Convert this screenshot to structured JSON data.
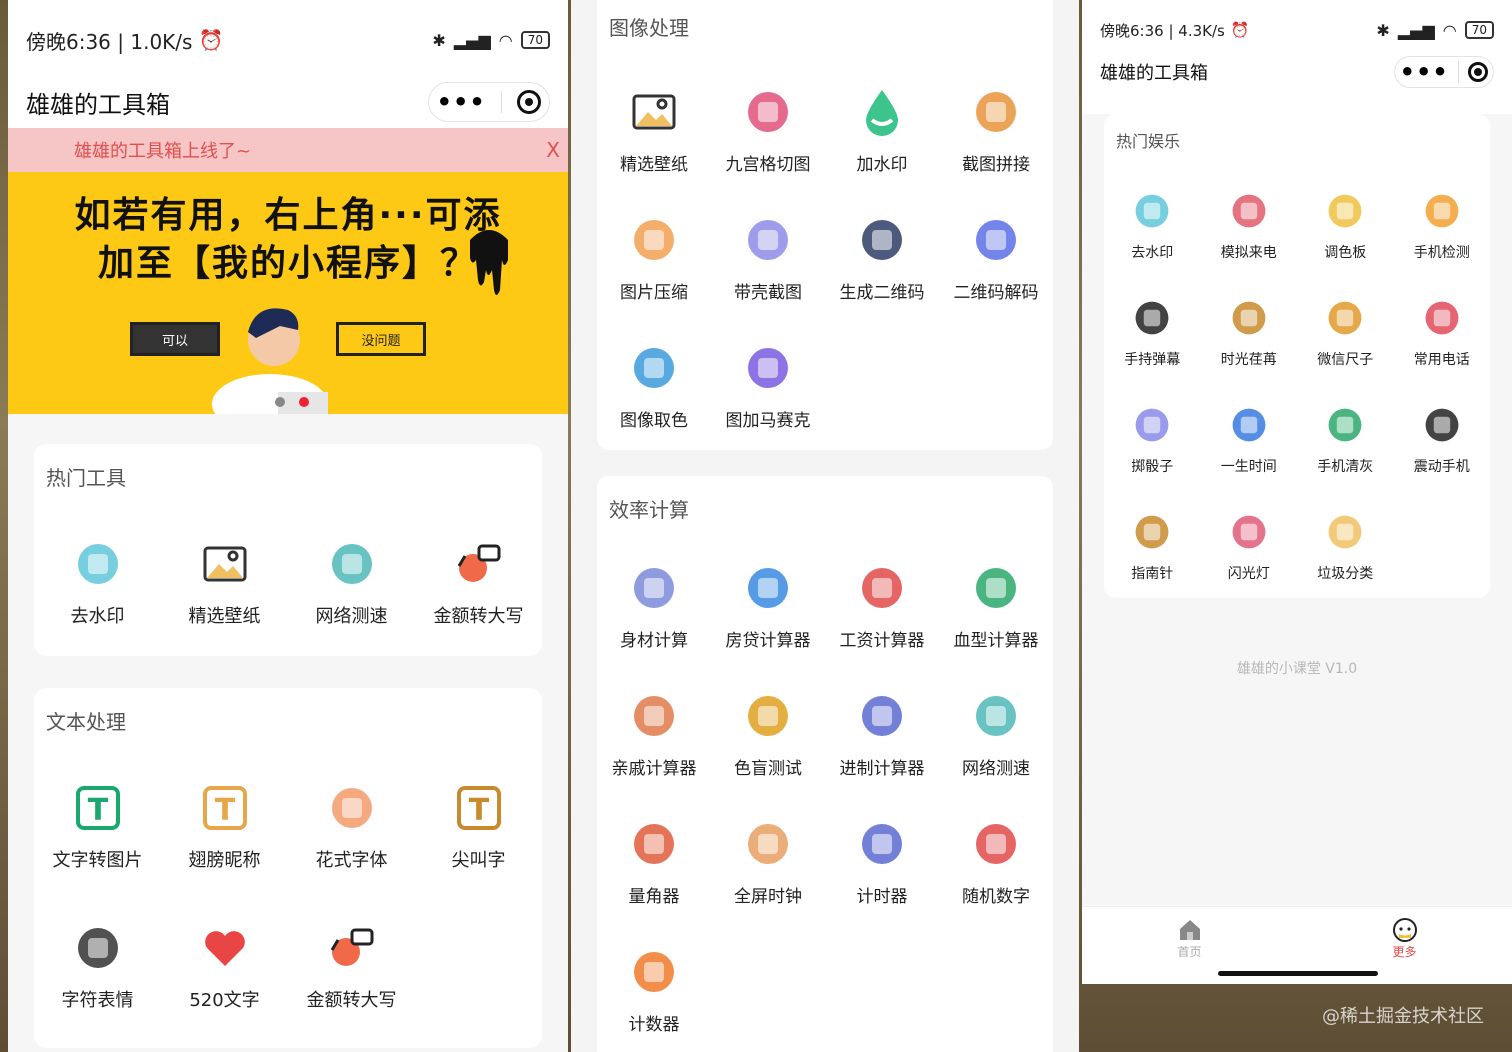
{
  "left": {
    "status": {
      "time": "傍晚6:36 | 1.0K/s",
      "battery": "70"
    },
    "title": "雄雄的工具箱",
    "notice": {
      "text": "雄雄的工具箱上线了~",
      "close": "X"
    },
    "banner": {
      "line1": "如若有用，右上角···可添",
      "line2": "加至【我的小程序】？",
      "btn_ok": "可以",
      "btn_no": "没问题"
    },
    "hot_tools": {
      "title": "热门工具",
      "items": [
        {
          "label": "去水印",
          "icon": "watermark-icon",
          "color": "#5fc6d8"
        },
        {
          "label": "精选壁纸",
          "icon": "image-icon",
          "color": "#333333"
        },
        {
          "label": "网络测速",
          "icon": "speed-gauge-icon",
          "color": "#4fb8b8"
        },
        {
          "label": "金额转大写",
          "icon": "exchange-icon",
          "color": "#f06a4a"
        }
      ]
    },
    "text_proc": {
      "title": "文本处理",
      "items": [
        {
          "label": "文字转图片",
          "icon": "text-t-icon",
          "color": "#1aa86e"
        },
        {
          "label": "翅膀昵称",
          "icon": "text-t-icon",
          "color": "#e8a64a"
        },
        {
          "label": "花式字体",
          "icon": "flower-icon",
          "color": "#f39a6b"
        },
        {
          "label": "尖叫字",
          "icon": "text-t-icon",
          "color": "#c9892d"
        },
        {
          "label": "字符表情",
          "icon": "symbols-icon",
          "color": "#333333"
        },
        {
          "label": "520文字",
          "icon": "heart-icon",
          "color": "#ea4545"
        },
        {
          "label": "金额转大写",
          "icon": "exchange-icon",
          "color": "#f06a4a"
        }
      ]
    }
  },
  "mid": {
    "image_proc": {
      "title": "图像处理",
      "items": [
        {
          "label": "精选壁纸",
          "icon": "image-icon",
          "color": "#333333"
        },
        {
          "label": "九宫格切图",
          "icon": "puzzle-icon",
          "color": "#e0507a"
        },
        {
          "label": "加水印",
          "icon": "water-drop-icon",
          "color": "#3cc48c"
        },
        {
          "label": "截图拼接",
          "icon": "crop-icon",
          "color": "#e8933a"
        },
        {
          "label": "图片压缩",
          "icon": "compress-icon",
          "color": "#f0a050"
        },
        {
          "label": "带壳截图",
          "icon": "phone-shot-icon",
          "color": "#8c8ce8"
        },
        {
          "label": "生成二维码",
          "icon": "qrcode-icon",
          "color": "#2d3e66"
        },
        {
          "label": "二维码解码",
          "icon": "qr-decode-icon",
          "color": "#5a6ee6"
        },
        {
          "label": "图像取色",
          "icon": "color-picker-icon",
          "color": "#3a9ad9"
        },
        {
          "label": "图加马赛克",
          "icon": "mosaic-icon",
          "color": "#7a5ae0"
        }
      ]
    },
    "efficiency": {
      "title": "效率计算",
      "items": [
        {
          "label": "身材计算",
          "icon": "scale-icon",
          "color": "#7a8ad8"
        },
        {
          "label": "房贷计算器",
          "icon": "building-icon",
          "color": "#3a8ae0"
        },
        {
          "label": "工资计算器",
          "icon": "salary-icon",
          "color": "#e04a4a"
        },
        {
          "label": "血型计算器",
          "icon": "blood-drop-icon",
          "color": "#2aa86a"
        },
        {
          "label": "亲戚计算器",
          "icon": "family-icon",
          "color": "#e07a4a"
        },
        {
          "label": "色盲测试",
          "icon": "color-circles-icon",
          "color": "#e0a020"
        },
        {
          "label": "进制计算器",
          "icon": "binary-icon",
          "color": "#5a6ad0"
        },
        {
          "label": "网络测速",
          "icon": "speed-gauge-icon",
          "color": "#4fb8b8"
        },
        {
          "label": "量角器",
          "icon": "protractor-icon",
          "color": "#e05a3a"
        },
        {
          "label": "全屏时钟",
          "icon": "stopwatch-icon",
          "color": "#e8a060"
        },
        {
          "label": "计时器",
          "icon": "timer-icon",
          "color": "#5a6ad0"
        },
        {
          "label": "随机数字",
          "icon": "random-number-icon",
          "color": "#e04a4a"
        },
        {
          "label": "计数器",
          "icon": "counter-icon",
          "color": "#f07a2a"
        }
      ]
    }
  },
  "right": {
    "status": {
      "time": "傍晚6:36 | 4.3K/s",
      "battery": "70"
    },
    "title": "雄雄的工具箱",
    "entertainment": {
      "title": "热门娱乐",
      "items": [
        {
          "label": "去水印",
          "icon": "watermark-icon",
          "color": "#5fc6d8"
        },
        {
          "label": "模拟来电",
          "icon": "telephone-icon",
          "color": "#e05a6a"
        },
        {
          "label": "调色板",
          "icon": "palette-icon",
          "color": "#f0c040"
        },
        {
          "label": "手机检测",
          "icon": "phone-check-icon",
          "color": "#f0a030"
        },
        {
          "label": "手持弹幕",
          "icon": "danmaku-icon",
          "color": "#222222"
        },
        {
          "label": "时光荏苒",
          "icon": "hourglass-icon",
          "color": "#c9892d"
        },
        {
          "label": "微信尺子",
          "icon": "ruler-icon",
          "color": "#e09a2a"
        },
        {
          "label": "常用电话",
          "icon": "contacts-icon",
          "color": "#e04a5a"
        },
        {
          "label": "掷骰子",
          "icon": "dice-icon",
          "color": "#8a8ae8"
        },
        {
          "label": "一生时间",
          "icon": "hourglass-icon",
          "color": "#3a7ae0"
        },
        {
          "label": "手机清灰",
          "icon": "brush-icon",
          "color": "#2aa86a"
        },
        {
          "label": "震动手机",
          "icon": "vibrate-icon",
          "color": "#222222"
        },
        {
          "label": "指南针",
          "icon": "compass-icon",
          "color": "#c9892d"
        },
        {
          "label": "闪光灯",
          "icon": "flashlight-icon",
          "color": "#e05a7a"
        },
        {
          "label": "垃圾分类",
          "icon": "trash-icon",
          "color": "#f0c060"
        }
      ]
    },
    "credit": "雄雄的小课堂 V1.0",
    "tabs": [
      {
        "label": "首页",
        "icon": "home-icon"
      },
      {
        "label": "更多",
        "icon": "more-icon"
      }
    ],
    "watermark": "@稀土掘金技术社区"
  }
}
